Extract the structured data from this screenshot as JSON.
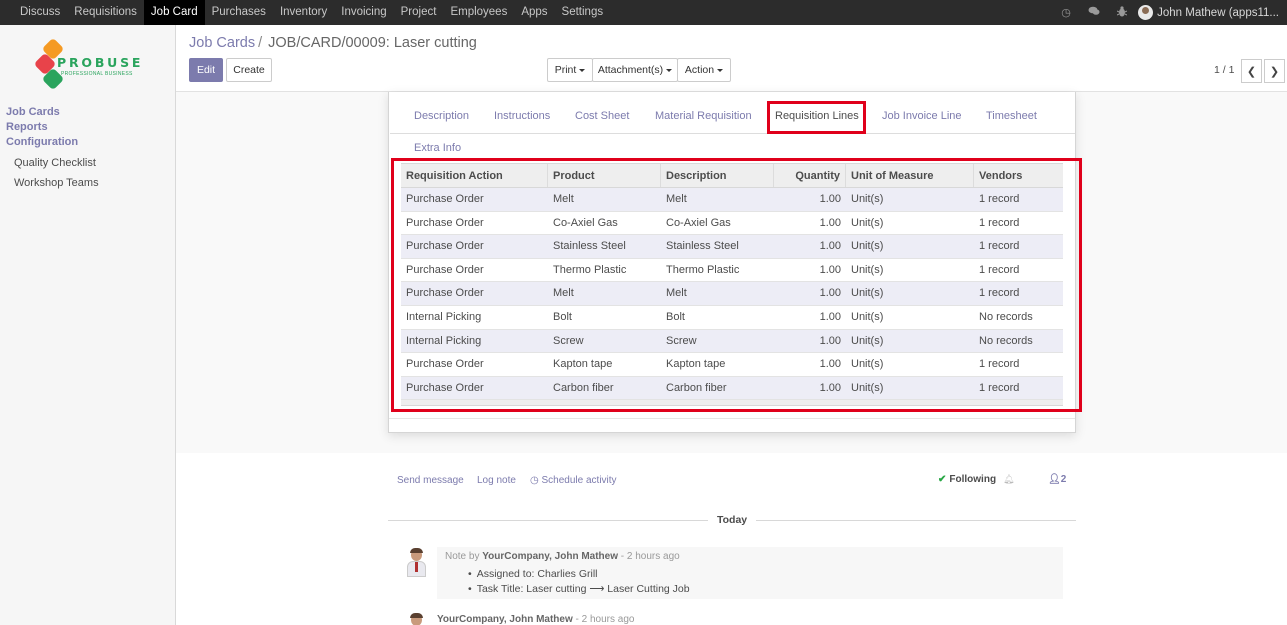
{
  "topnav": {
    "items": [
      "Discuss",
      "Requisitions",
      "Job Card",
      "Purchases",
      "Inventory",
      "Invoicing",
      "Project",
      "Employees",
      "Apps",
      "Settings"
    ],
    "active": "Job Card",
    "user": "John Mathew (apps11..."
  },
  "logo": {
    "brand": "PROBUSE",
    "tagline": "PROFESSIONAL BUSINESS"
  },
  "sidebar": {
    "job_cards": "Job Cards",
    "reports": "Reports",
    "configuration": "Configuration",
    "quality_checklist": "Quality Checklist",
    "workshop_teams": "Workshop Teams"
  },
  "breadcrumb": {
    "parent": "Job Cards",
    "sep": "/",
    "current": "JOB/CARD/00009: Laser cutting"
  },
  "buttons": {
    "edit": "Edit",
    "create": "Create",
    "print": "Print",
    "attachments": "Attachment(s)",
    "action": "Action"
  },
  "pager": {
    "value": "1 / 1"
  },
  "tabs": {
    "description": "Description",
    "instructions": "Instructions",
    "cost_sheet": "Cost Sheet",
    "material_requisition": "Material Requisition",
    "requisition_lines": "Requisition Lines",
    "job_invoice_line": "Job Invoice Line",
    "timesheet": "Timesheet",
    "extra_info": "Extra Info"
  },
  "table": {
    "headers": {
      "action": "Requisition Action",
      "product": "Product",
      "description": "Description",
      "quantity": "Quantity",
      "uom": "Unit of Measure",
      "vendors": "Vendors"
    },
    "rows": [
      [
        "Purchase Order",
        "Melt",
        "Melt",
        "1.00",
        "Unit(s)",
        "1 record"
      ],
      [
        "Purchase Order",
        "Co-Axiel Gas",
        "Co-Axiel Gas",
        "1.00",
        "Unit(s)",
        "1 record"
      ],
      [
        "Purchase Order",
        "Stainless Steel",
        "Stainless Steel",
        "1.00",
        "Unit(s)",
        "1 record"
      ],
      [
        "Purchase Order",
        "Thermo Plastic",
        "Thermo Plastic",
        "1.00",
        "Unit(s)",
        "1 record"
      ],
      [
        "Purchase Order",
        "Melt",
        "Melt",
        "1.00",
        "Unit(s)",
        "1 record"
      ],
      [
        "Internal Picking",
        "Bolt",
        "Bolt",
        "1.00",
        "Unit(s)",
        "No records"
      ],
      [
        "Internal Picking",
        "Screw",
        "Screw",
        "1.00",
        "Unit(s)",
        "No records"
      ],
      [
        "Purchase Order",
        "Kapton tape",
        "Kapton tape",
        "1.00",
        "Unit(s)",
        "1 record"
      ],
      [
        "Purchase Order",
        "Carbon fiber",
        "Carbon fiber",
        "1.00",
        "Unit(s)",
        "1 record"
      ]
    ]
  },
  "chatter": {
    "send_message": "Send message",
    "log_note": "Log note",
    "schedule_activity": "Schedule activity",
    "following": "Following",
    "followers_count": "2",
    "today": "Today",
    "note_prefix": "Note by",
    "note_author": "YourCompany, John Mathew",
    "note_time": "- 2 hours ago",
    "note_item1": "Assigned to: Charlies Grill",
    "note_item2": "Task Title: Laser cutting ⟶ Laser Cutting Job",
    "msg2_author": "YourCompany, John Mathew",
    "msg2_time": "- 2 hours ago"
  },
  "colors": {
    "accent": "#7c7bad",
    "highlight": "#e0001b",
    "navbar": "#2c2c2c"
  }
}
